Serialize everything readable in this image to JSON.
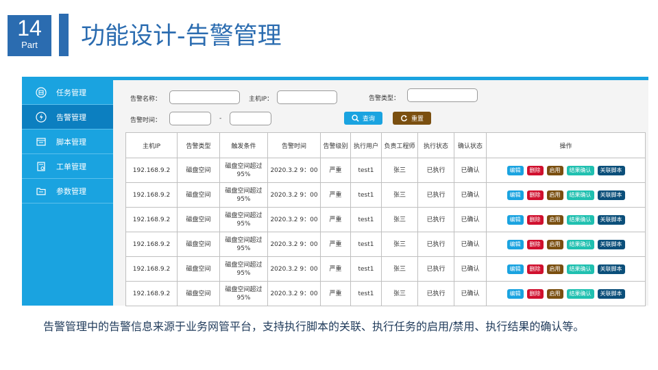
{
  "header": {
    "part_number": "14",
    "part_label": "Part",
    "title": "功能设计-告警管理"
  },
  "sidebar": {
    "items": [
      {
        "label": "任务管理",
        "icon": "task-icon"
      },
      {
        "label": "告警管理",
        "icon": "alarm-icon",
        "active": true
      },
      {
        "label": "脚本管理",
        "icon": "script-icon"
      },
      {
        "label": "工单管理",
        "icon": "workorder-icon"
      },
      {
        "label": "参数管理",
        "icon": "parameter-icon"
      }
    ]
  },
  "filters": {
    "alarm_name_label": "告警名称：",
    "host_ip_label": "主机IP：",
    "alarm_type_label": "告警类型：",
    "alarm_time_label": "告警时间：",
    "range_separator": "-",
    "query_label": "查询",
    "reset_label": "重置"
  },
  "table": {
    "columns": [
      "主机IP",
      "告警类型",
      "触发条件",
      "告警时间",
      "告警级别",
      "执行用户",
      "负责工程师",
      "执行状态",
      "确认状态",
      "操作"
    ],
    "rows": [
      [
        "192.168.9.2",
        "磁盘空间",
        "磁盘空间超过95%",
        "2020.3.2 9：00",
        "严重",
        "test1",
        "张三",
        "已执行",
        "已确认"
      ],
      [
        "192.168.9.2",
        "磁盘空间",
        "磁盘空间超过95%",
        "2020.3.2 9：00",
        "严重",
        "test1",
        "张三",
        "已执行",
        "已确认"
      ],
      [
        "192.168.9.2",
        "磁盘空间",
        "磁盘空间超过95%",
        "2020.3.2 9：00",
        "严重",
        "test1",
        "张三",
        "已执行",
        "已确认"
      ],
      [
        "192.168.9.2",
        "磁盘空间",
        "磁盘空间超过95%",
        "2020.3.2 9：00",
        "严重",
        "test1",
        "张三",
        "已执行",
        "已确认"
      ],
      [
        "192.168.9.2",
        "磁盘空间",
        "磁盘空间超过95%",
        "2020.3.2 9：00",
        "严重",
        "test1",
        "张三",
        "已执行",
        "已确认"
      ],
      [
        "192.168.9.2",
        "磁盘空间",
        "磁盘空间超过95%",
        "2020.3.2 9：00",
        "严重",
        "test1",
        "张三",
        "已执行",
        "已确认"
      ]
    ],
    "actions": [
      {
        "label": "编辑",
        "color": "#1aa3e0"
      },
      {
        "label": "删除",
        "color": "#d0102e"
      },
      {
        "label": "启用",
        "color": "#7a4f10"
      },
      {
        "label": "结果确认",
        "color": "#20c0b0"
      },
      {
        "label": "关联脚本",
        "color": "#0b4f7a"
      }
    ]
  },
  "caption": "告警管理中的告警信息来源于业务网管平台，支持执行脚本的关联、执行任务的启用/禁用、执行结果的确认等。",
  "colors": {
    "brand": "#2b6cb0",
    "sidebar": "#1aa3e0",
    "sidebar_active": "#0c7fc0"
  }
}
